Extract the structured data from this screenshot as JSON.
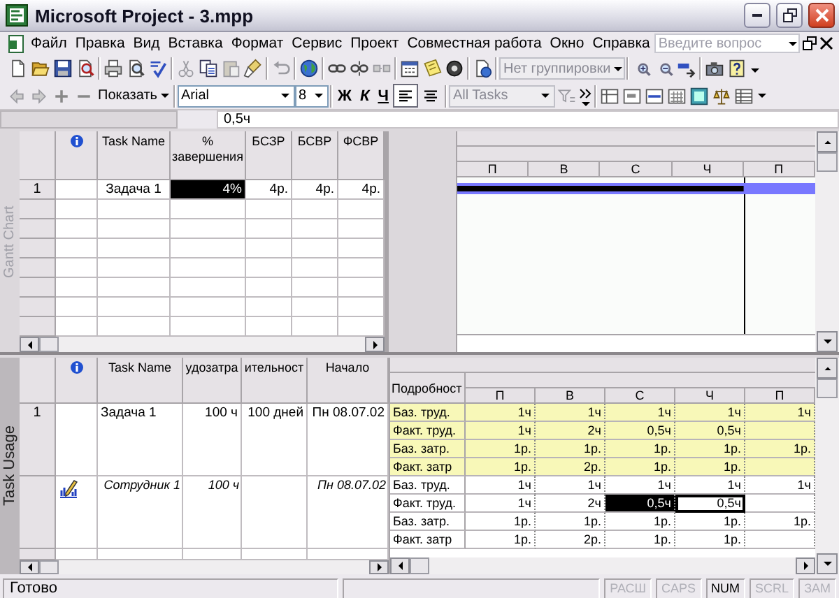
{
  "window": {
    "title": "Microsoft Project - 3.mpp"
  },
  "menu": {
    "items": [
      "Файл",
      "Правка",
      "Вид",
      "Вставка",
      "Формат",
      "Сервис",
      "Проект",
      "Совместная работа",
      "Окно",
      "Справка"
    ],
    "help_search": {
      "placeholder": "Введите вопрос"
    }
  },
  "standard_toolbar": {
    "grouping": {
      "value": "Нет группировки",
      "disabled": true
    }
  },
  "formatting_toolbar": {
    "show_button": "Показать",
    "font": "Arial",
    "font_size": "8",
    "style_buttons": [
      "Ж",
      "К",
      "Ч"
    ],
    "alignment": [
      {
        "kind": "left",
        "selected": true
      },
      {
        "kind": "center",
        "selected": false
      }
    ],
    "filter": {
      "value": "All Tasks",
      "disabled": true
    }
  },
  "entry_bar": {
    "value": "0,5ч"
  },
  "gantt_view": {
    "label": "Gantt Chart",
    "columns": [
      "Task Name",
      "% завершения",
      "БСЗР",
      "БСВР",
      "ФСВР"
    ],
    "rows": [
      {
        "id": "1",
        "cells": [
          {
            "text": "Задача 1",
            "selected": false
          },
          {
            "text": "4%",
            "selected": true
          },
          {
            "text": "4р.",
            "selected": false
          },
          {
            "text": "4р.",
            "selected": false
          },
          {
            "text": "4р.",
            "selected": false
          }
        ]
      }
    ],
    "timescale": [
      "П",
      "В",
      "С",
      "Ч",
      "П"
    ]
  },
  "usage_view": {
    "label": "Task Usage",
    "columns": [
      "Task Name",
      "удозатра",
      "ительност",
      "Начало"
    ],
    "details_header": "Подробност",
    "timescale": [
      "П",
      "В",
      "С",
      "Ч",
      "П"
    ],
    "rows": [
      {
        "kind": "task",
        "id": "1",
        "name": "Задача 1",
        "work": "100 ч",
        "duration": "100 дней",
        "start": "Пн 08.07.02",
        "details": [
          {
            "label": "Баз. труд.",
            "values": [
              "1ч",
              "1ч",
              "1ч",
              "1ч",
              "1ч"
            ]
          },
          {
            "label": "Факт. труд.",
            "values": [
              "1ч",
              "2ч",
              "0,5ч",
              "0,5ч"
            ]
          },
          {
            "label": "Баз. затр.",
            "values": [
              "1р.",
              "1р.",
              "1р.",
              "1р.",
              "1р."
            ]
          },
          {
            "label": "Факт. затр",
            "values": [
              "1р.",
              "2р.",
              "1р.",
              "1р."
            ]
          }
        ]
      },
      {
        "kind": "assignment",
        "name": "Сотрудник 1",
        "work": "100 ч",
        "start": "Пн 08.07.02",
        "details": [
          {
            "label": "Баз. труд.",
            "values": [
              "1ч",
              "1ч",
              "1ч",
              "1ч",
              "1ч"
            ]
          },
          {
            "label": "Факт. труд.",
            "values": [
              {
                "text": "1ч",
                "selected": false,
                "active": false
              },
              {
                "text": "2ч",
                "selected": false,
                "active": false
              },
              {
                "text": "0,5ч",
                "selected": true,
                "active": false
              },
              {
                "text": "0,5ч",
                "selected": false,
                "active": true
              }
            ]
          },
          {
            "label": "Баз. затр.",
            "values": [
              "1р.",
              "1р.",
              "1р.",
              "1р.",
              "1р."
            ]
          },
          {
            "label": "Факт. затр",
            "values": [
              "1р.",
              "2р.",
              "1р.",
              "1р."
            ]
          }
        ]
      }
    ]
  },
  "status_bar": {
    "message": "Готово",
    "indicators": [
      {
        "label": "РАСШ",
        "on": false
      },
      {
        "label": "CAPS",
        "on": false
      },
      {
        "label": "NUM",
        "on": true
      },
      {
        "label": "SCRL",
        "on": false
      },
      {
        "label": "ЗАМ",
        "on": false
      }
    ]
  }
}
